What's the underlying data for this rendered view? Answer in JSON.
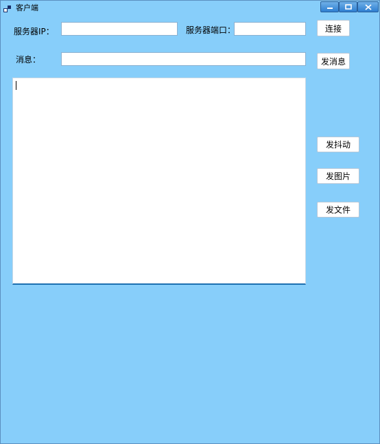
{
  "window": {
    "title": "客户端",
    "icon": "app-window-icon",
    "controls": [
      "minimize-icon",
      "maximize-icon",
      "close-icon"
    ]
  },
  "form": {
    "server_ip_label": "服务器IP：",
    "server_ip_value": "",
    "server_port_label": "服务器端口：",
    "server_port_value": "",
    "connect_label": "连接",
    "message_label": "消息：",
    "message_value": "",
    "send_message_label": "发消息"
  },
  "log": {
    "content": ""
  },
  "actions": {
    "shake_label": "发抖动",
    "picture_label": "发图片",
    "file_label": "发文件"
  },
  "colors": {
    "background": "#87cefa",
    "log_border": "#1c6fb0"
  }
}
